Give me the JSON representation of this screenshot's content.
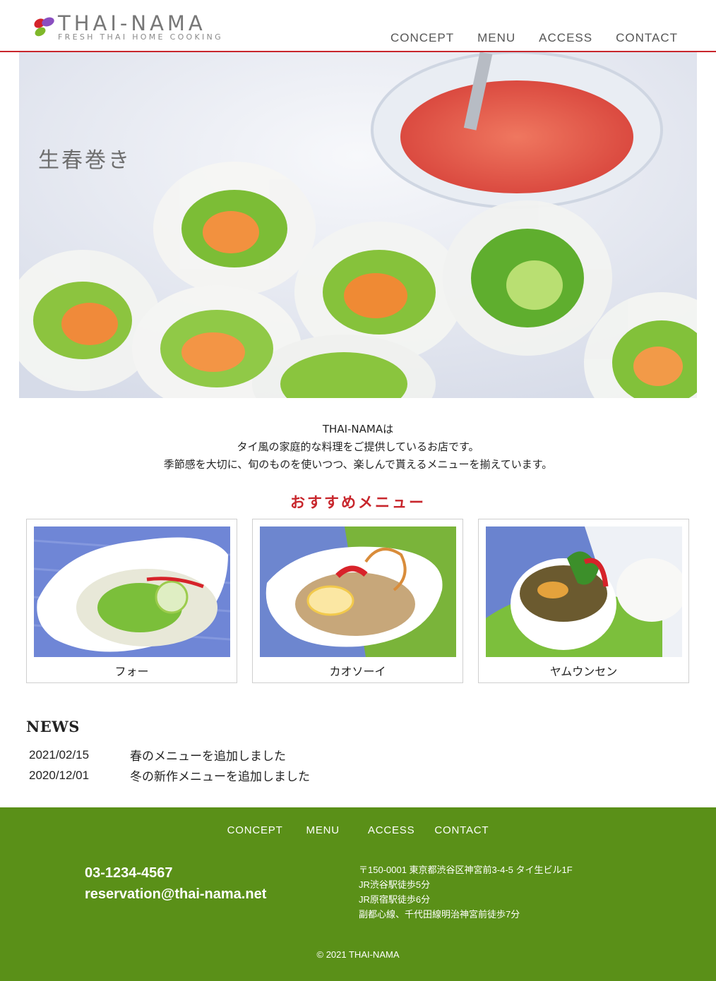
{
  "brand": {
    "name": "THAI-NAMA",
    "tagline": "FRESH THAI HOME COOKING"
  },
  "nav": [
    {
      "label": "CONCEPT"
    },
    {
      "label": "MENU"
    },
    {
      "label": "ACCESS"
    },
    {
      "label": "CONTACT"
    }
  ],
  "hero": {
    "caption": "生春巻き"
  },
  "intro": {
    "lines": [
      "THAI-NAMAは",
      "タイ風の家庭的な料理をご提供しているお店です。",
      "季節感を大切に、旬のものを使いつつ、楽しんで貰えるメニューを揃えています。"
    ]
  },
  "recommended": {
    "title": "おすすめメニュー",
    "items": [
      {
        "label": "フォー"
      },
      {
        "label": "カオソーイ"
      },
      {
        "label": "ヤムウンセン"
      }
    ]
  },
  "news": {
    "title": "NEWS",
    "items": [
      {
        "date": "2021/02/15",
        "text": "春のメニューを追加しました"
      },
      {
        "date": "2020/12/01",
        "text": "冬の新作メニューを追加しました"
      }
    ]
  },
  "footer": {
    "nav": [
      {
        "label": "CONCEPT"
      },
      {
        "label": "MENU"
      },
      {
        "label": "ACCESS"
      },
      {
        "label": "CONTACT"
      }
    ],
    "phone": "03-1234-4567",
    "email": "reservation@thai-nama.net",
    "address": [
      "〒150-0001 東京都渋谷区神宮前3-4-5 タイ生ビル1F",
      "JR渋谷駅徒歩5分",
      "JR原宿駅徒歩6分",
      "副都心線、千代田線明治神宮前徒歩7分"
    ],
    "copyright": "© 2021 THAI-NAMA"
  },
  "colors": {
    "accent": "#c8262c",
    "footer_bg": "#5a9018",
    "text": "#222222"
  }
}
